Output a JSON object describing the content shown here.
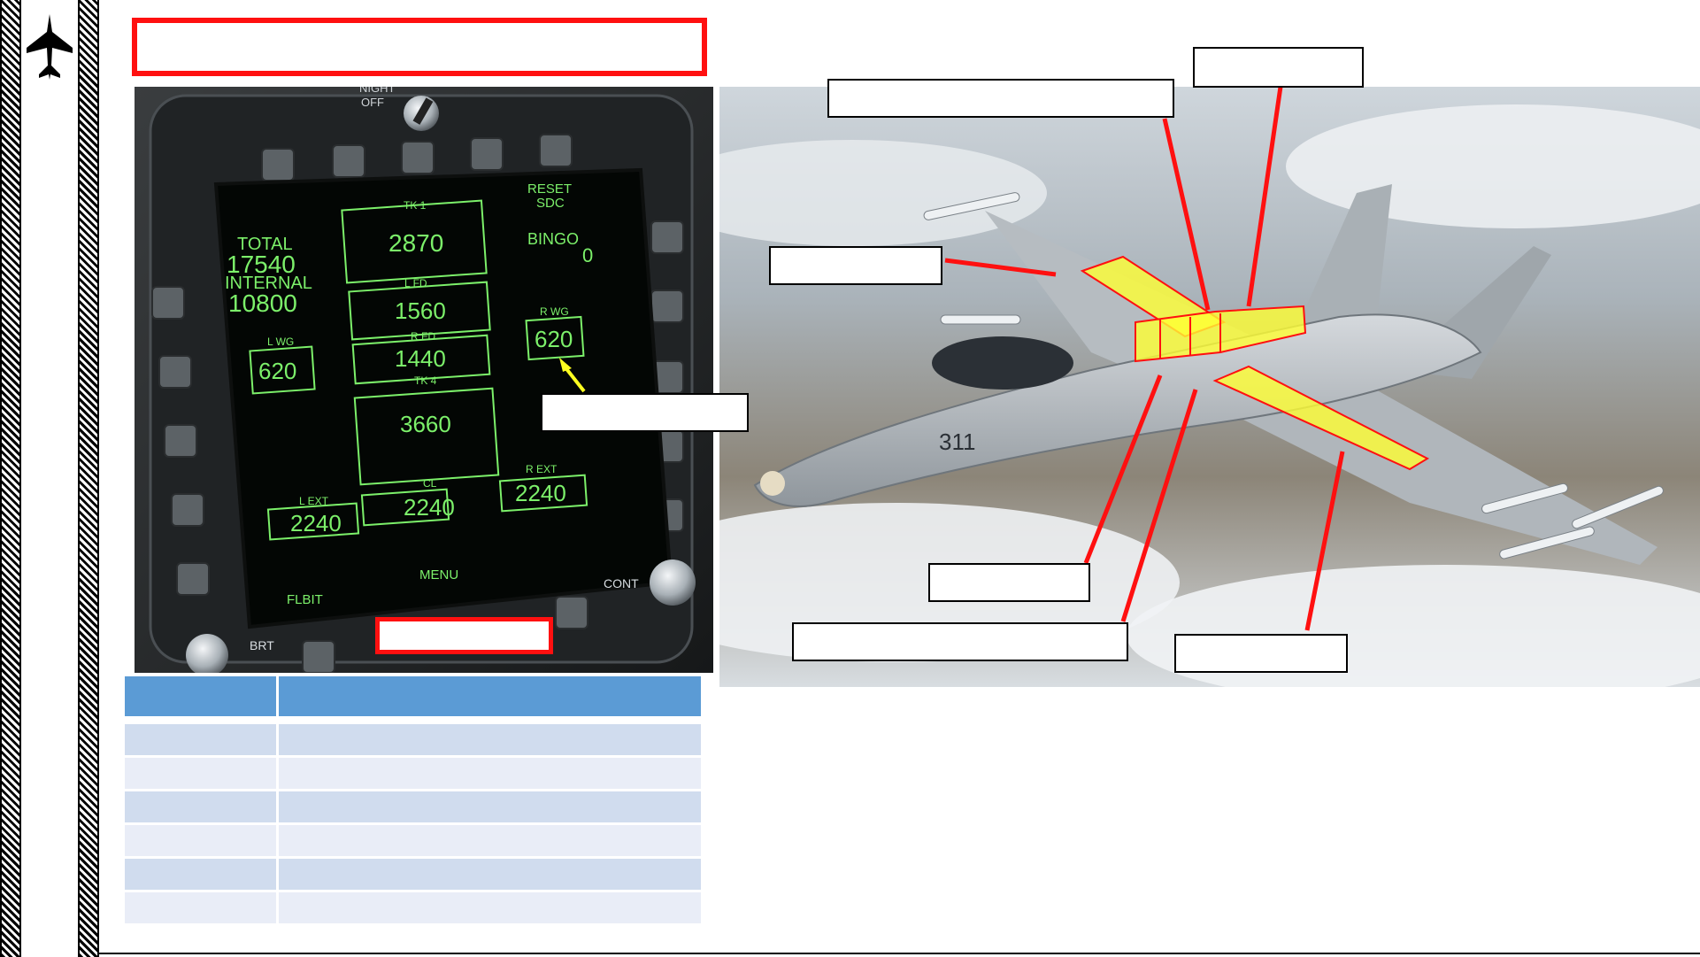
{
  "sidebar": {
    "logo_icon": "fighter-jet-icon"
  },
  "slide": {
    "title": ""
  },
  "mfd": {
    "night_label": "NIGHT",
    "off_label": "OFF",
    "tk1_label": "TK 1",
    "tk1_value": "2870",
    "reset_label": "RESET",
    "sdc_label": "SDC",
    "bingo_label": "BINGO",
    "bingo_value": "0",
    "total_label": "TOTAL",
    "total_value": "17540",
    "internal_label": "INTERNAL",
    "internal_value": "10800",
    "lfd_label": "L FD",
    "lfd_value": "1560",
    "rwg_label": "R WG",
    "rwg_value": "620",
    "lwg_label": "L WG",
    "lwg_value": "620",
    "rfd_label": "R FD",
    "rfd_value": "1440",
    "tk4_label": "TK 4",
    "tk4_value": "3660",
    "rext_label": "R EXT",
    "rext_value": "2240",
    "cl_label": "CL",
    "cl_value": "2240",
    "lext_label": "L EXT",
    "lext_value": "2240",
    "flbit_label": "FLBIT",
    "menu_label": "MENU",
    "cont_label": "CONT",
    "brt_label": "BRT",
    "display_color": "#7cf06a",
    "arrow_color": "#ffff20"
  },
  "jet": {
    "side_number": "311",
    "highlight_color": "#ffff33",
    "arrow_color": "#ff1010"
  },
  "legend_table": {
    "header": [
      "",
      ""
    ],
    "rows": [
      [
        "",
        ""
      ],
      [
        "",
        ""
      ],
      [
        "",
        ""
      ],
      [
        "",
        ""
      ],
      [
        "",
        ""
      ],
      [
        "",
        ""
      ]
    ]
  }
}
